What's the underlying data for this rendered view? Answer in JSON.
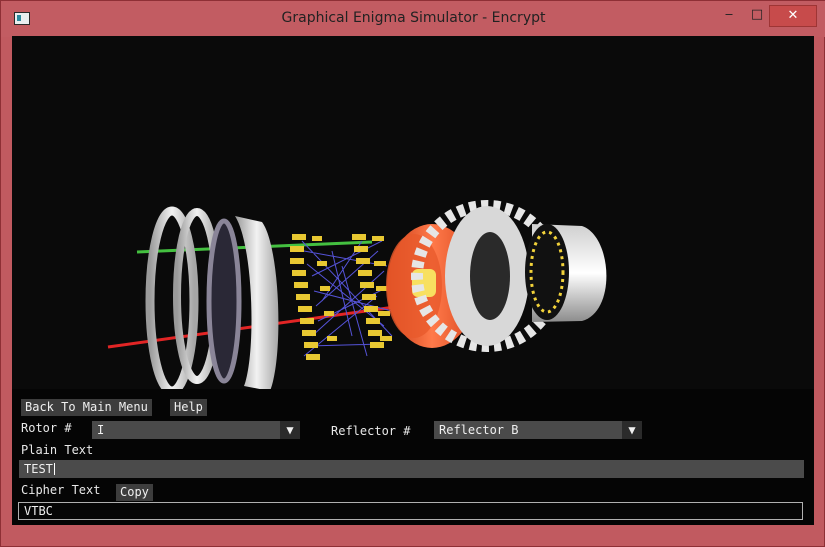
{
  "window": {
    "title": "Graphical Enigma Simulator - Encrypt",
    "minimize_icon": "minimize-icon",
    "maximize_icon": "maximize-icon",
    "close_icon": "close-icon",
    "frame_color": "#c15a60"
  },
  "viewport": {
    "description_icon": "enigma-3d-model",
    "background": "#0a0a0a"
  },
  "controls": {
    "back_button": "Back To Main Menu",
    "help_button": "Help",
    "rotor_label": "Rotor #",
    "rotor_value": "I",
    "reflector_label": "Reflector #",
    "reflector_value": "Reflector B",
    "plain_text_label": "Plain Text",
    "plain_text_value": "TEST",
    "cipher_text_label": "Cipher Text",
    "copy_button": "Copy",
    "cipher_text_value": "VTBC",
    "dropdown_icon": "▼"
  }
}
